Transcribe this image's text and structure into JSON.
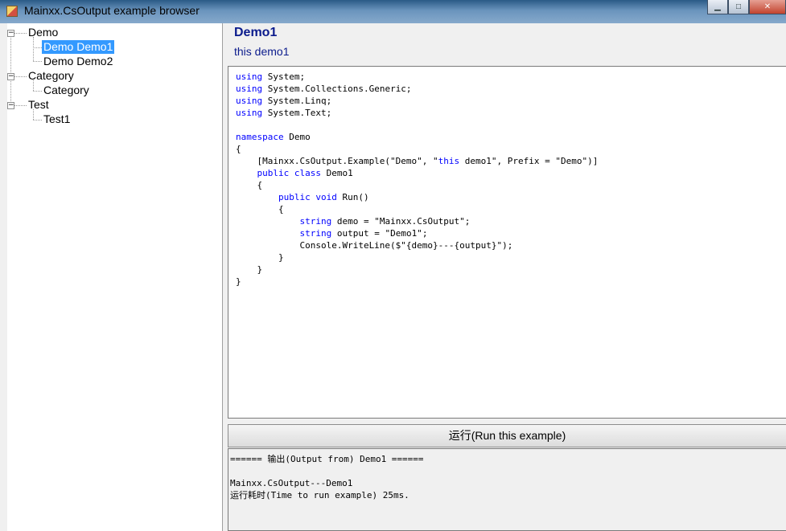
{
  "window": {
    "title": "Mainxx.CsOutput example browser",
    "minimize": "▁",
    "maximize": "□",
    "close": "✕"
  },
  "tree": {
    "expander_glyph": "−",
    "nodes": [
      {
        "label": "Demo"
      },
      {
        "label": "Demo Demo1",
        "selected": true
      },
      {
        "label": "Demo Demo2"
      },
      {
        "label": "Category"
      },
      {
        "label": "Category"
      },
      {
        "label": "Test"
      },
      {
        "label": "Test1"
      }
    ]
  },
  "example": {
    "title": "Demo1",
    "description": "this demo1"
  },
  "code": {
    "lines": [
      {
        "kw": "using",
        "rest": " System;"
      },
      {
        "kw": "using",
        "rest": " System.Collections.Generic;"
      },
      {
        "kw": "using",
        "rest": " System.Linq;"
      },
      {
        "kw": "using",
        "rest": " System.Text;"
      },
      {
        "kw": "",
        "rest": ""
      },
      {
        "kw": "namespace",
        "rest": " Demo"
      },
      {
        "kw": "",
        "rest": "{"
      },
      {
        "pre": "    [Mainxx.CsOutput.Example(\"Demo\", \"",
        "kw": "this",
        "rest": " demo1\", Prefix = \"Demo\")]"
      },
      {
        "pre": "    ",
        "kw": "public class",
        "rest": " Demo1"
      },
      {
        "kw": "",
        "rest": "    {"
      },
      {
        "pre": "        ",
        "kw": "public void",
        "rest": " Run()"
      },
      {
        "kw": "",
        "rest": "        {"
      },
      {
        "pre": "            ",
        "kw": "string",
        "rest": " demo = \"Mainxx.CsOutput\";"
      },
      {
        "pre": "            ",
        "kw": "string",
        "rest": " output = \"Demo1\";"
      },
      {
        "kw": "",
        "rest": "            Console.WriteLine($\"{demo}---{output}\");"
      },
      {
        "kw": "",
        "rest": "        }"
      },
      {
        "kw": "",
        "rest": "    }"
      },
      {
        "kw": "",
        "rest": "}"
      }
    ]
  },
  "run_button": {
    "label": "运行(Run this example)"
  },
  "output": {
    "lines": [
      "====== 输出(Output from) Demo1 ======",
      "",
      "Mainxx.CsOutput---Demo1",
      "运行耗时(Time to run example) 25ms."
    ]
  },
  "colors": {
    "keyword": "#0000ff",
    "title": "#0b1b8c",
    "selection": "#3399ff"
  }
}
